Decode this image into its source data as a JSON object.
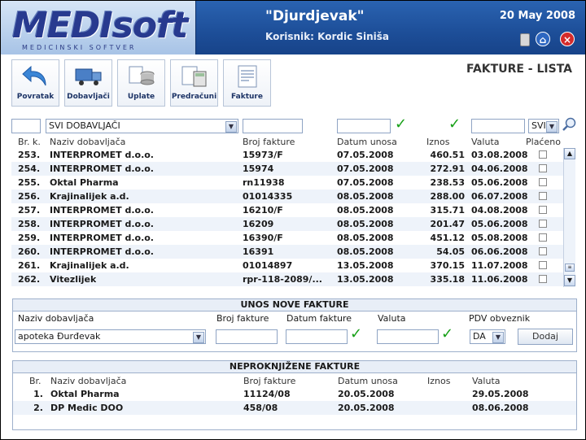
{
  "header": {
    "logo_text": "MEDIsoft",
    "logo_subtitle": "MEDICINSKI SOFTVER",
    "pharmacy_name": "\"Djurdjevak\"",
    "user": "Korisnik: Kordic Siniša",
    "date": "20 May 2008"
  },
  "toolbar": [
    {
      "label": "Povratak",
      "icon": "back-arrow-icon"
    },
    {
      "label": "Dobavljači",
      "icon": "truck-icon"
    },
    {
      "label": "Uplate",
      "icon": "coins-icon"
    },
    {
      "label": "Predračuni",
      "icon": "calculator-icon"
    },
    {
      "label": "Fakture",
      "icon": "invoice-icon"
    }
  ],
  "page_title": "FAKTURE - LISTA",
  "filters": {
    "supplier": "SVI DOBAVLJAČI",
    "status": "SVI"
  },
  "table": {
    "headers": [
      "Br. k.",
      "Naziv dobavljača",
      "Broj fakture",
      "Datum unosa",
      "Iznos",
      "Valuta",
      "Plaćeno"
    ],
    "rows": [
      {
        "no": "253.",
        "supplier": "INTERPROMET d.o.o.",
        "invoice": "15973/F",
        "date": "07.05.2008",
        "amount": "460.51",
        "due": "03.08.2008"
      },
      {
        "no": "254.",
        "supplier": "INTERPROMET d.o.o.",
        "invoice": "15974",
        "date": "07.05.2008",
        "amount": "272.91",
        "due": "04.06.2008"
      },
      {
        "no": "255.",
        "supplier": "Oktal Pharma",
        "invoice": "rn11938",
        "date": "07.05.2008",
        "amount": "238.53",
        "due": "05.06.2008"
      },
      {
        "no": "256.",
        "supplier": "Krajinalijek a.d.",
        "invoice": "01014335",
        "date": "08.05.2008",
        "amount": "288.00",
        "due": "06.07.2008"
      },
      {
        "no": "257.",
        "supplier": "INTERPROMET d.o.o.",
        "invoice": "16210/F",
        "date": "08.05.2008",
        "amount": "315.71",
        "due": "04.08.2008"
      },
      {
        "no": "258.",
        "supplier": "INTERPROMET d.o.o.",
        "invoice": "16209",
        "date": "08.05.2008",
        "amount": "201.47",
        "due": "05.06.2008"
      },
      {
        "no": "259.",
        "supplier": "INTERPROMET d.o.o.",
        "invoice": "16390/F",
        "date": "08.05.2008",
        "amount": "451.12",
        "due": "05.08.2008"
      },
      {
        "no": "260.",
        "supplier": "INTERPROMET d.o.o.",
        "invoice": "16391",
        "date": "08.05.2008",
        "amount": "54.05",
        "due": "06.06.2008"
      },
      {
        "no": "261.",
        "supplier": "Krajinalijek a.d.",
        "invoice": "01014897",
        "date": "13.05.2008",
        "amount": "370.15",
        "due": "11.07.2008"
      },
      {
        "no": "262.",
        "supplier": "Vitezlijek",
        "invoice": "rpr-118-2089/...",
        "date": "13.05.2008",
        "amount": "335.18",
        "due": "11.06.2008"
      }
    ]
  },
  "new_invoice": {
    "title": "UNOS NOVE FAKTURE",
    "col_supplier": "Naziv dobavljača",
    "col_invoice": "Broj fakture",
    "col_date": "Datum fakture",
    "col_due": "Valuta",
    "col_vat": "PDV obveznik",
    "supplier_value": "apoteka Đurđevak",
    "vat_value": "DA",
    "add_button": "Dodaj"
  },
  "unbooked": {
    "title": "NEPROKNJIŽENE FAKTURE",
    "headers": [
      "Br.",
      "Naziv dobavljača",
      "Broj fakture",
      "Datum unosa",
      "Iznos",
      "Valuta"
    ],
    "rows": [
      {
        "no": "1.",
        "supplier": "Oktal Pharma",
        "invoice": "11124/08",
        "date": "20.05.2008",
        "amount": "",
        "due": "29.05.2008"
      },
      {
        "no": "2.",
        "supplier": "DP Medic DOO",
        "invoice": "458/08",
        "date": "20.05.2008",
        "amount": "",
        "due": "08.06.2008"
      }
    ]
  },
  "colors": {
    "header_blue": "#1d4e98",
    "row_alt": "#eef3fa",
    "check_green": "#17a017"
  }
}
